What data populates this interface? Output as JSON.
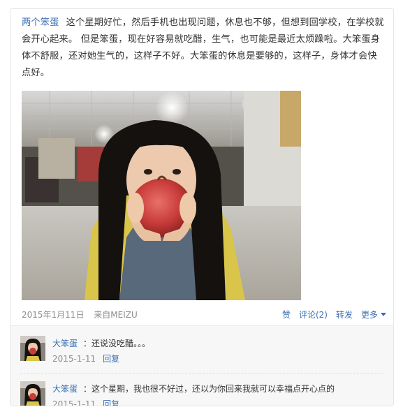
{
  "post": {
    "author": "两个笨蛋",
    "text": "这个星期好忙，然后手机也出现问题，休息也不够，但想到回学校，在学校就会开心起来。 但是笨蛋，现在好容易就吃醋，生气，也可能是最近太烦躁啦。大笨蛋身体不舒服，还对她生气的，这样子不好。大笨蛋的休息是要够的，这样子，身体才会快点好。",
    "date": "2015年1月11日",
    "source": "来自MEIZU",
    "actions": {
      "like": "赞",
      "comment": "评论(2)",
      "repost": "转发",
      "more": "更多"
    }
  },
  "comments": [
    {
      "user": "大笨蛋",
      "text": "：还说没吃醋。。。",
      "date": "2015-1-11",
      "reply": "回复"
    },
    {
      "user": "大笨蛋",
      "text": "：这个星期，我也很不好过，还以为你回来我就可以幸福点开心点的",
      "date": "2015-1-11",
      "reply": "回复"
    }
  ],
  "colors": {
    "link": "#3c6fb4",
    "meta": "#8c8c8c",
    "text": "#333333",
    "comment_bg": "#f7f7f7"
  },
  "icons": {
    "more_caret": "caret-down-icon"
  }
}
